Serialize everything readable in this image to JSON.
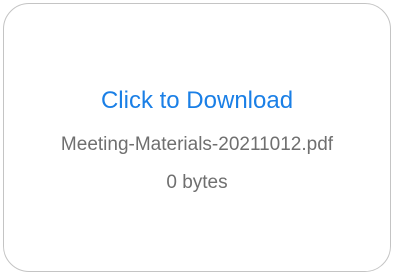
{
  "download_card": {
    "link_label": "Click to Download",
    "file_name": "Meeting-Materials-20211012.pdf",
    "file_size": "0 bytes"
  },
  "colors": {
    "link": "#1a7fe6",
    "meta_text": "#6f6f6f",
    "border": "#c4c4c4"
  }
}
